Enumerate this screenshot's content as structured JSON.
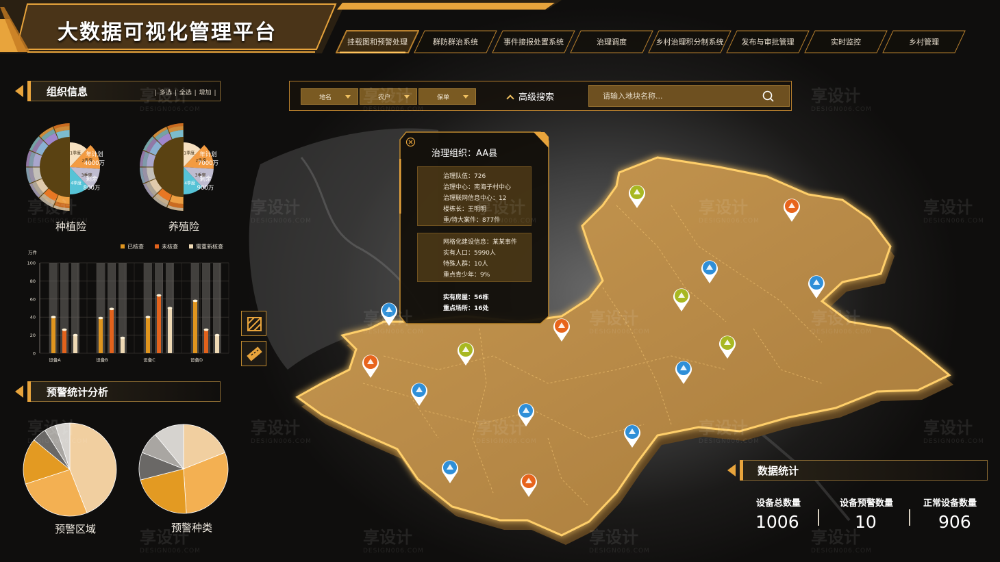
{
  "header": {
    "title": "大数据可视化管理平台",
    "nav_tabs": [
      {
        "label": "挂载图和预警处理",
        "active": true
      },
      {
        "label": "群防群治系统",
        "active": false
      },
      {
        "label": "事件接报处置系统",
        "active": false
      },
      {
        "label": "治理调度",
        "active": false
      },
      {
        "label": "乡村治理积分制系统",
        "active": false
      },
      {
        "label": "发布与审批管理",
        "active": false
      },
      {
        "label": "实时监控",
        "active": false
      },
      {
        "label": "乡村管理",
        "active": false
      }
    ]
  },
  "org_info": {
    "title": "组织信息",
    "actions": [
      "多选",
      "全选",
      "增加"
    ],
    "pies": [
      {
        "name": "种植险",
        "plan_label": "年计划",
        "plan_value": "4000万",
        "remain_label": "剩余",
        "remain_value": "800万",
        "slices": [
          {
            "label": "1季度",
            "value": 12
          },
          {
            "label": "2季度",
            "value": 14
          },
          {
            "label": "3季度",
            "value": 12
          },
          {
            "label": "4季度",
            "value": 12
          },
          {
            "label": "",
            "value": 50
          }
        ]
      },
      {
        "name": "养殖险",
        "plan_label": "年计划",
        "plan_value": "7000万",
        "remain_label": "剩余",
        "remain_value": "900万",
        "slices": [
          {
            "label": "1季度",
            "value": 12
          },
          {
            "label": "2季度",
            "value": 14
          },
          {
            "label": "3季度",
            "value": 12
          },
          {
            "label": "4季度",
            "value": 12
          },
          {
            "label": "",
            "value": 50
          }
        ]
      }
    ]
  },
  "chart_data": [
    {
      "type": "bar",
      "ylabel": "万件",
      "ylim": [
        0,
        100
      ],
      "yticks": [
        0,
        20,
        40,
        60,
        80,
        100
      ],
      "categories": [
        "设备A",
        "设备B",
        "设备C",
        "设备D"
      ],
      "legend_position": "top-right",
      "grid": true,
      "series": [
        {
          "name": "已核查",
          "color": "#e0951e",
          "values": [
            40,
            39,
            40,
            58
          ]
        },
        {
          "name": "未核查",
          "color": "#e2621c",
          "values": [
            26,
            49,
            64,
            26
          ]
        },
        {
          "name": "需重新核查",
          "color": "#efd9b4",
          "values": [
            20,
            17,
            50,
            20
          ]
        }
      ]
    },
    {
      "type": "pie",
      "title": "预警区域",
      "slices": [
        {
          "value": 44,
          "color": "#f1cfa0"
        },
        {
          "value": 26,
          "color": "#f3b052"
        },
        {
          "value": 16,
          "color": "#e39a22"
        },
        {
          "value": 5,
          "color": "#6a6866"
        },
        {
          "value": 4,
          "color": "#a9a6a2"
        },
        {
          "value": 5,
          "color": "#d6d3cf"
        }
      ]
    },
    {
      "type": "pie",
      "title": "预警种类",
      "slices": [
        {
          "value": 19,
          "color": "#f1cfa0"
        },
        {
          "value": 30,
          "color": "#f3b052"
        },
        {
          "value": 22,
          "color": "#e39a22"
        },
        {
          "value": 10,
          "color": "#6a6866"
        },
        {
          "value": 8,
          "color": "#a9a6a2"
        },
        {
          "value": 11,
          "color": "#d6d3cf"
        }
      ]
    }
  ],
  "warning_stats": {
    "title": "预警统计分析"
  },
  "search": {
    "dropdowns": [
      "地名",
      "农户",
      "保单"
    ],
    "advanced_label": "高级搜索",
    "placeholder": "请输入地块名称..."
  },
  "popup": {
    "title": "治理组织：AA县",
    "group1": [
      "治理队伍：726",
      "治理中心：南海子村中心",
      "治理联网信息中心：12",
      "楼栋长：王明明",
      "重/特大案件：877件"
    ],
    "group2": [
      "网格化建设信息：某某事件",
      "实有人口：5990人",
      "特殊人群：10人",
      "重点青少年：9%"
    ],
    "footer": [
      "实有房屋：56栋",
      "重点场所：16处"
    ]
  },
  "data_stats": {
    "title": "数据统计",
    "items": [
      {
        "label": "设备总数量",
        "value": "1006"
      },
      {
        "label": "设备预警数量",
        "value": "10"
      },
      {
        "label": "正常设备数量",
        "value": "906"
      }
    ]
  },
  "watermark": {
    "text": "享设计",
    "sub": "DESIGN006.COM"
  },
  "colors": {
    "accent": "#e8a43c",
    "map_fill": "#b98a46",
    "bg": "#0e0c0a"
  }
}
